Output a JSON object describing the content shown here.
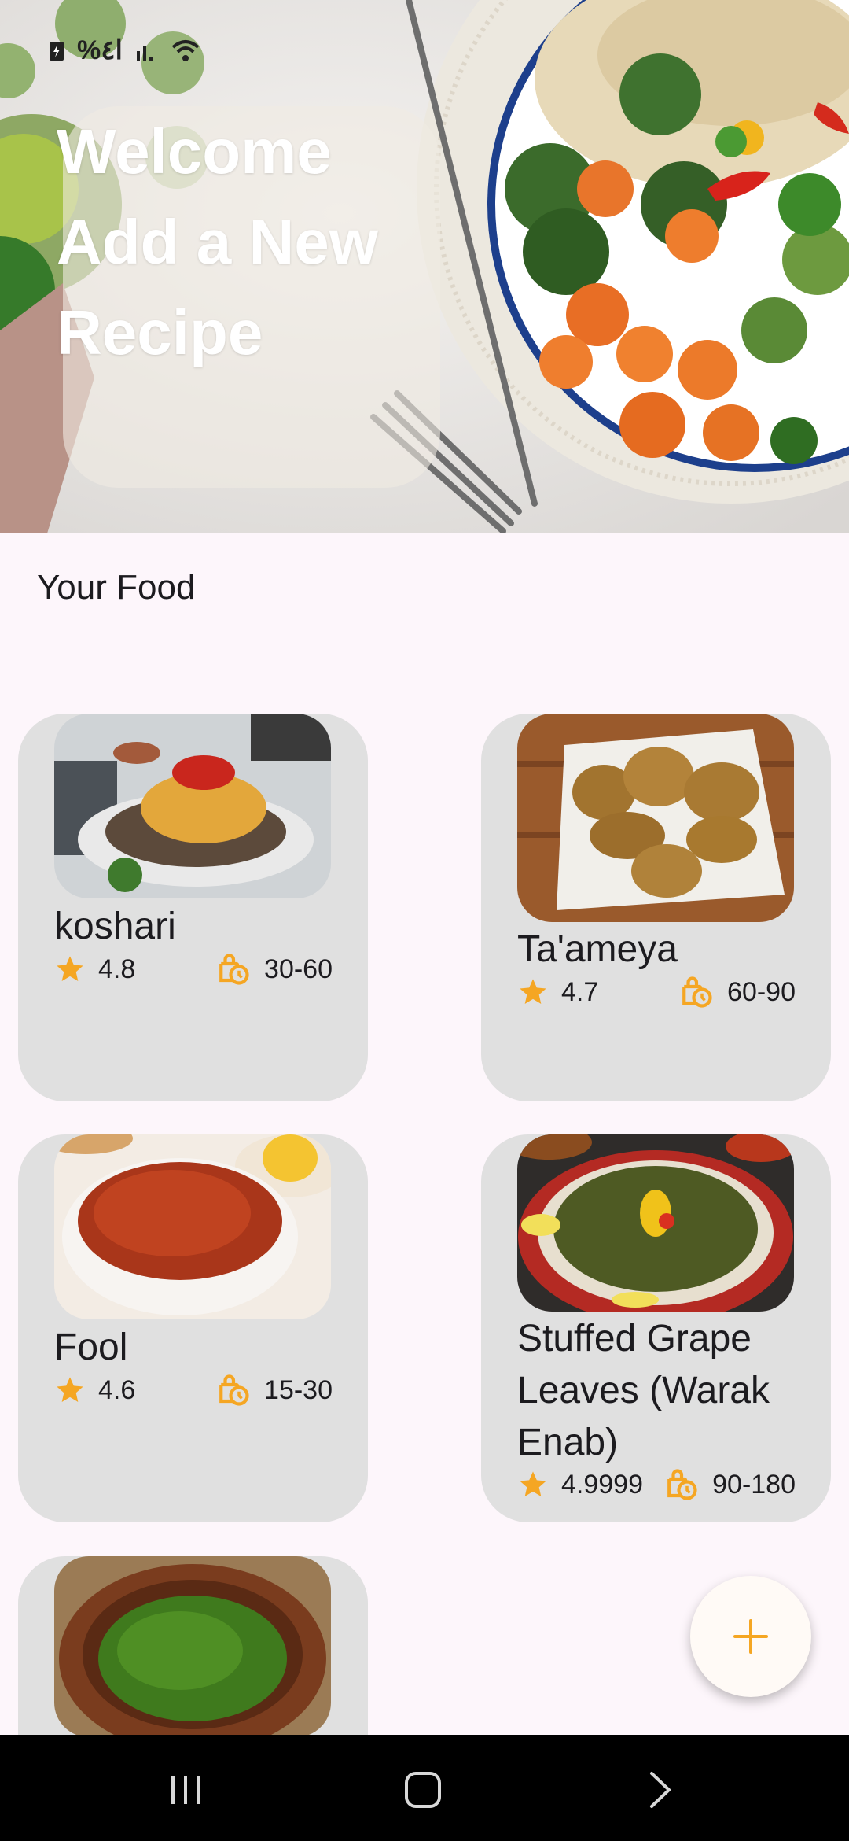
{
  "status_bar": {
    "percent_text": "%ا٤"
  },
  "hero": {
    "lines": [
      "Welcome",
      "Add a New",
      "Recipe"
    ]
  },
  "section": {
    "title": "Your Food"
  },
  "colors": {
    "accent": "#f5a623",
    "card_bg": "#e0e0e0",
    "page_bg": "#fdf6fb"
  },
  "recipes": [
    {
      "name": "koshari",
      "rating": "4.8",
      "time": "30-60"
    },
    {
      "name": "Ta'ameya",
      "rating": "4.7",
      "time": "60-90"
    },
    {
      "name": "Fool",
      "rating": "4.6",
      "time": "15-30"
    },
    {
      "name_lines": [
        "Stuffed Grape",
        "Leaves (Warak",
        "Enab)"
      ],
      "rating": "4.9999",
      "time": "90-180"
    },
    {
      "name": ""
    }
  ],
  "icons": {
    "rating": "star-icon",
    "time": "timer-icon",
    "fab": "plus-icon"
  },
  "navbar": {
    "items": [
      "recents-icon",
      "home-icon",
      "back-icon"
    ]
  }
}
